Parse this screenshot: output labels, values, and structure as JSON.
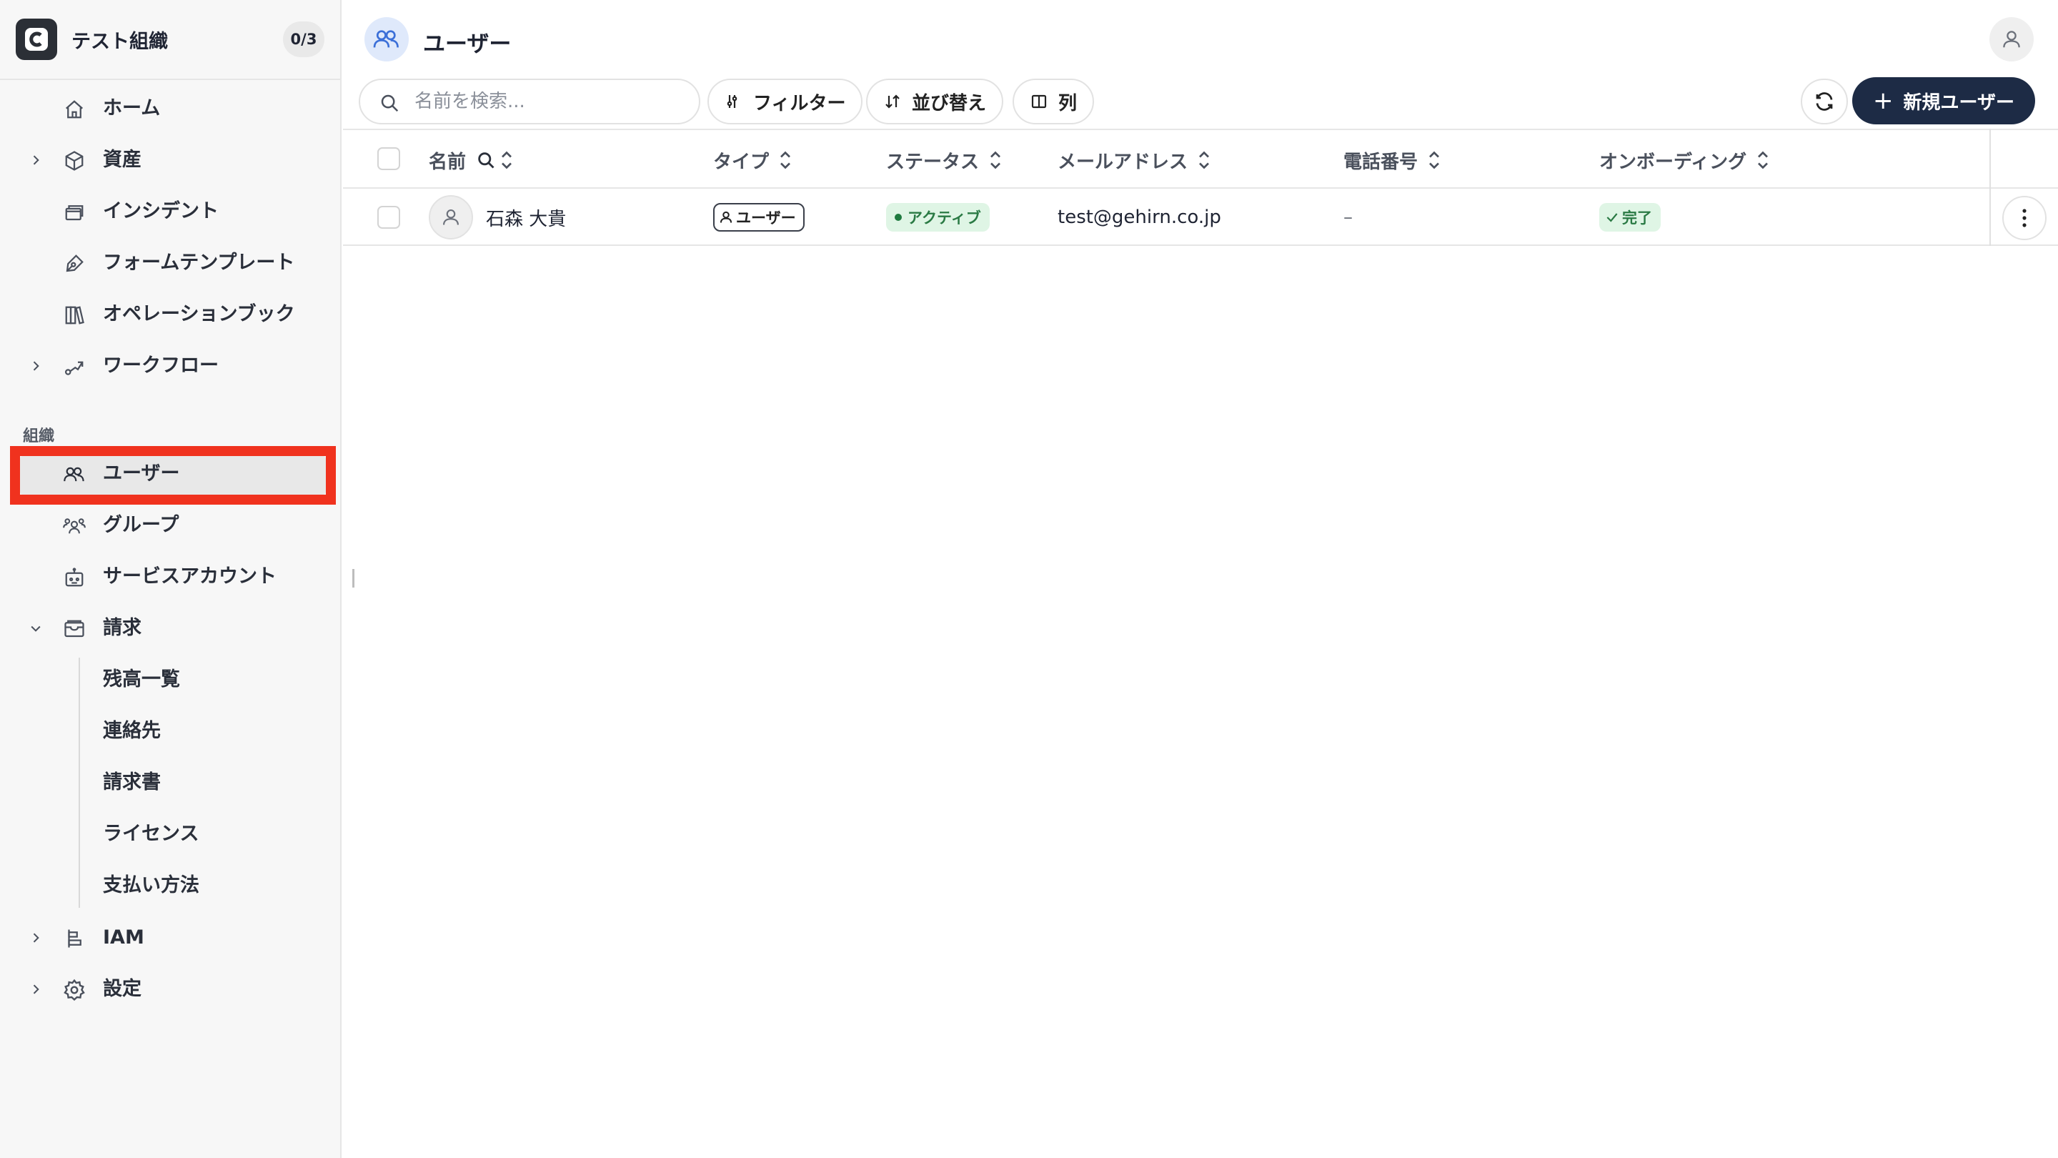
{
  "sidebar": {
    "org_name": "テスト組織",
    "org_count": "0/3",
    "items": [
      {
        "label": "ホーム",
        "icon": "home-icon"
      },
      {
        "label": "資産",
        "icon": "cube-icon"
      },
      {
        "label": "インシデント",
        "icon": "window-stack-icon"
      },
      {
        "label": "フォームテンプレート",
        "icon": "pen-icon"
      },
      {
        "label": "オペレーションブック",
        "icon": "books-icon"
      },
      {
        "label": "ワークフロー",
        "icon": "route-icon"
      }
    ],
    "section_label": "組織",
    "org_items": [
      {
        "label": "ユーザー",
        "icon": "users-icon"
      },
      {
        "label": "グループ",
        "icon": "group-icon"
      },
      {
        "label": "サービスアカウント",
        "icon": "robot-icon"
      },
      {
        "label": "請求",
        "icon": "wallet-icon"
      }
    ],
    "billing_sub": [
      "残高一覧",
      "連絡先",
      "請求書",
      "ライセンス",
      "支払い方法"
    ],
    "bottom_items": [
      {
        "label": "IAM",
        "icon": "iam-icon"
      },
      {
        "label": "設定",
        "icon": "gear-icon"
      }
    ]
  },
  "header": {
    "title": "ユーザー"
  },
  "toolbar": {
    "search_placeholder": "名前を検索...",
    "filter_label": "フィルター",
    "sort_label": "並び替え",
    "columns_label": "列",
    "new_user_label": "新規ユーザー"
  },
  "table": {
    "columns": [
      "名前",
      "タイプ",
      "ステータス",
      "メールアドレス",
      "電話番号",
      "オンボーディング"
    ],
    "rows": [
      {
        "name": "石森 大貴",
        "type": "ユーザー",
        "status": "アクティブ",
        "email": "test@gehirn.co.jp",
        "phone": "–",
        "onboarding": "完了"
      }
    ]
  },
  "colors": {
    "accent_dark": "#1d2b45",
    "highlight_red": "#f0321e",
    "status_green_bg": "#dff5e5",
    "status_green_text": "#2a7a44"
  }
}
